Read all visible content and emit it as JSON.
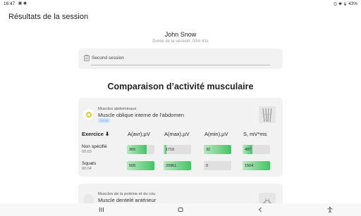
{
  "status_bar": {
    "time": "16:47",
    "battery": "43%"
  },
  "header": {
    "title": "Résultats de la session"
  },
  "user": {
    "name": "John Snow",
    "duration": "Durée de la session: 00m 41s"
  },
  "session": {
    "name": "Second session"
  },
  "comparison": {
    "title": "Comparaison d’activité musculaire",
    "muscle": {
      "group": "Muscles abdominaux",
      "name": "Muscle oblique interne de l'abdomen",
      "tag": "03:00"
    },
    "columns": {
      "exercise": "Exercice ⬇",
      "avr": "A(avr),µV",
      "max": "A(max),µV",
      "min": "A(min),µV",
      "s": "S, mV*ms"
    },
    "rows": [
      {
        "name": "Non spécifié",
        "duration": "00:03",
        "avr": "365",
        "avr_level": 0.72,
        "max": "1710",
        "max_level": 0.1,
        "min": "32",
        "min_level": 1.0,
        "s": "497",
        "s_level": 0.35
      },
      {
        "name": "Squats",
        "duration": "00:04",
        "avr": "505",
        "avr_level": 1.0,
        "max": "20961",
        "max_level": 1.0,
        "min": "0",
        "min_level": 0.0,
        "s": "1504",
        "s_level": 1.0
      }
    ],
    "muscle2": {
      "group": "Muscles de la poitrine et du cou",
      "name": "Muscle dentelé antérieur"
    }
  },
  "colors": {
    "bar_fill": "#43c464",
    "bar_track": "#e0e0e0",
    "card_bg": "#f2f2f2",
    "marker_yellow": "#e8c826"
  },
  "icons": [
    "wifi-icon",
    "battery-icon",
    "note-icon",
    "muscle-thumbnail",
    "back-icon",
    "home-icon",
    "recents-icon",
    "accessibility-icon"
  ]
}
